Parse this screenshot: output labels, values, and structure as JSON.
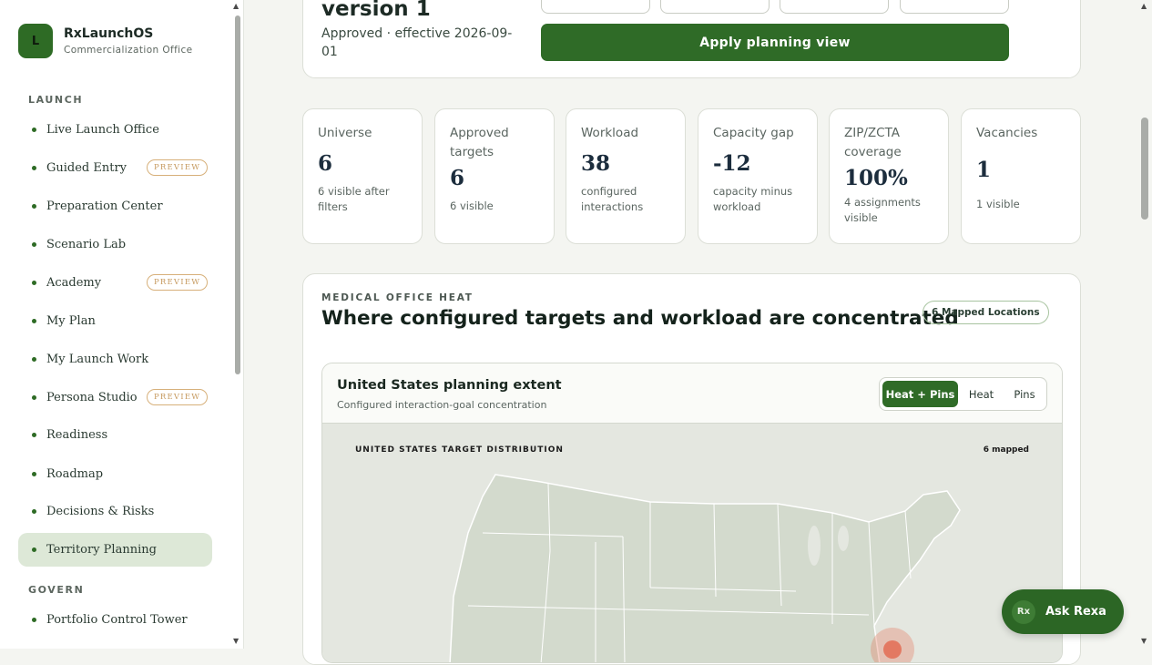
{
  "brand": {
    "logo_letter": "L",
    "name": "RxLaunchOS",
    "subtitle": "Commercialization Office"
  },
  "sidebar": {
    "sections": [
      {
        "label": "LAUNCH"
      },
      {
        "label": "GOVERN"
      }
    ],
    "items": [
      {
        "label": "Live Launch Office",
        "badge": ""
      },
      {
        "label": "Guided Entry",
        "badge": "PREVIEW"
      },
      {
        "label": "Preparation Center",
        "badge": ""
      },
      {
        "label": "Scenario Lab",
        "badge": ""
      },
      {
        "label": "Academy",
        "badge": "PREVIEW"
      },
      {
        "label": "My Plan",
        "badge": ""
      },
      {
        "label": "My Launch Work",
        "badge": ""
      },
      {
        "label": "Persona Studio",
        "badge": "PREVIEW"
      },
      {
        "label": "Readiness",
        "badge": ""
      },
      {
        "label": "Roadmap",
        "badge": ""
      },
      {
        "label": "Decisions & Risks",
        "badge": ""
      },
      {
        "label": "Territory Planning",
        "badge": "",
        "active": true
      },
      {
        "label": "Portfolio Control Tower",
        "badge": ""
      }
    ]
  },
  "version_card": {
    "title": "version 1",
    "subtitle": "Approved · effective 2026-09-01",
    "apply_label": "Apply planning view"
  },
  "metrics": [
    {
      "label": "Universe",
      "value": "6",
      "note": "6 visible after filters"
    },
    {
      "label": "Approved targets",
      "value": "6",
      "note": "6 visible"
    },
    {
      "label": "Workload",
      "value": "38",
      "note": "configured interactions"
    },
    {
      "label": "Capacity gap",
      "value": "-12",
      "note": "capacity minus workload"
    },
    {
      "label": "ZIP/ZCTA coverage",
      "value": "100%",
      "note": "4 assignments visible"
    },
    {
      "label": "Vacancies",
      "value": "1",
      "note": "1 visible"
    }
  ],
  "heat": {
    "eyebrow": "MEDICAL OFFICE HEAT",
    "title": "Where configured targets and workload are concentrated",
    "pill": "6 Mapped Locations",
    "panel_title": "United States planning extent",
    "panel_sub": "Configured interaction-goal concentration",
    "toggles": [
      "Heat + Pins",
      "Heat",
      "Pins"
    ],
    "active_toggle": "Heat + Pins",
    "map_label": "UNITED STATES TARGET DISTRIBUTION",
    "map_count": "6 mapped"
  },
  "assistant": {
    "icon": "Rx",
    "label": "Ask Rexa"
  },
  "colors": {
    "accent": "#2f6b27",
    "active_nav": "#dde8d7",
    "badge": "#c69a5f"
  }
}
